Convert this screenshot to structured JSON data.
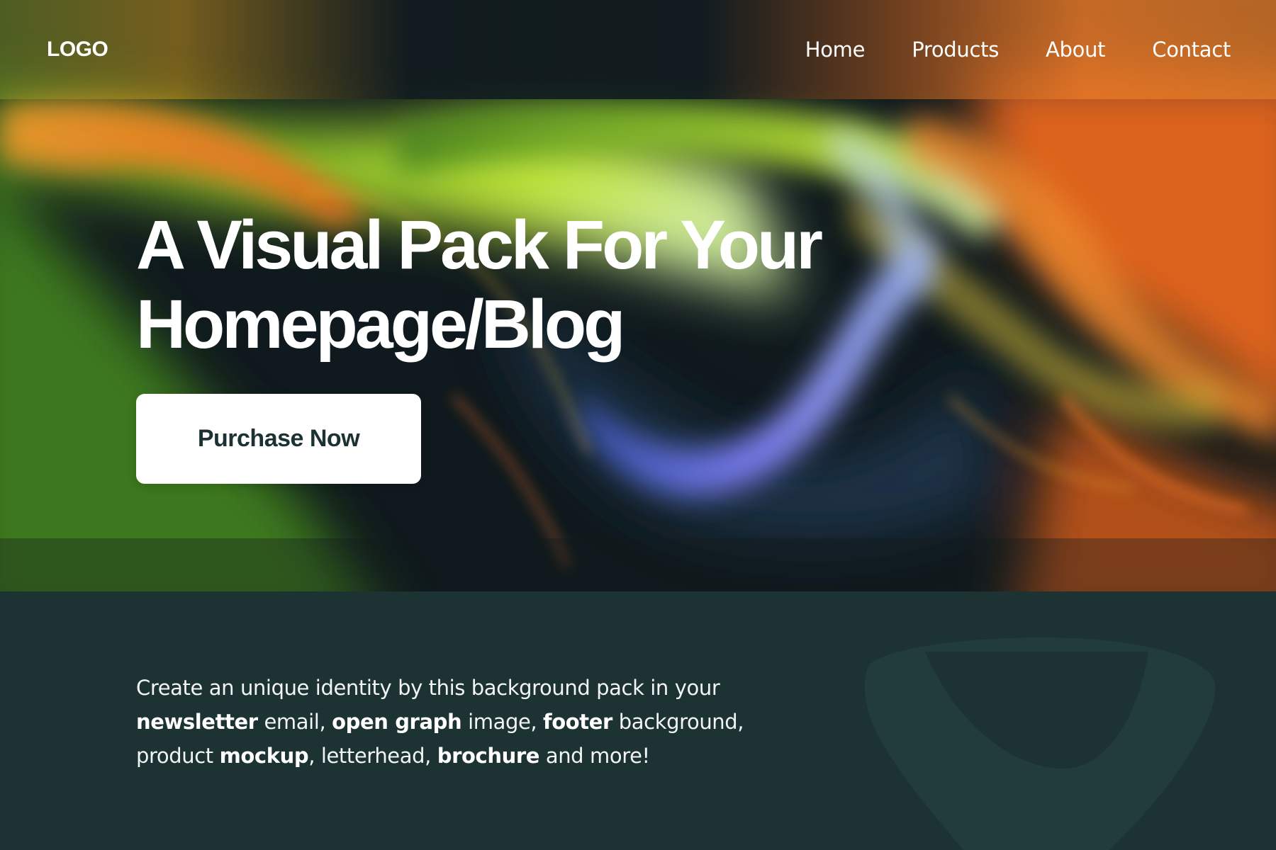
{
  "header": {
    "logo": "LOGO",
    "nav": [
      {
        "label": "Home"
      },
      {
        "label": "Products"
      },
      {
        "label": "About"
      },
      {
        "label": "Contact"
      }
    ]
  },
  "hero": {
    "title_line1": "A Visual Pack For Your",
    "title_line2": "Homepage/Blog",
    "cta_label": "Purchase Now"
  },
  "info": {
    "description": [
      {
        "text": "Create an unique identity by this background pack in your ",
        "bold": false
      },
      {
        "text": "newsletter",
        "bold": true
      },
      {
        "text": " email, ",
        "bold": false
      },
      {
        "text": "open graph",
        "bold": true
      },
      {
        "text": " image, ",
        "bold": false
      },
      {
        "text": "footer",
        "bold": true
      },
      {
        "text": " background, product ",
        "bold": false
      },
      {
        "text": "mockup",
        "bold": true
      },
      {
        "text": ", letterhead, ",
        "bold": false
      },
      {
        "text": "brochure",
        "bold": true
      },
      {
        "text": " and more!",
        "bold": false
      }
    ]
  },
  "colors": {
    "section_bg": "#1c3233",
    "button_bg": "#ffffff",
    "button_text": "#1b3133",
    "accent_green": "#b6e630",
    "accent_orange": "#f07a25",
    "accent_violet": "#7a7cf0"
  }
}
